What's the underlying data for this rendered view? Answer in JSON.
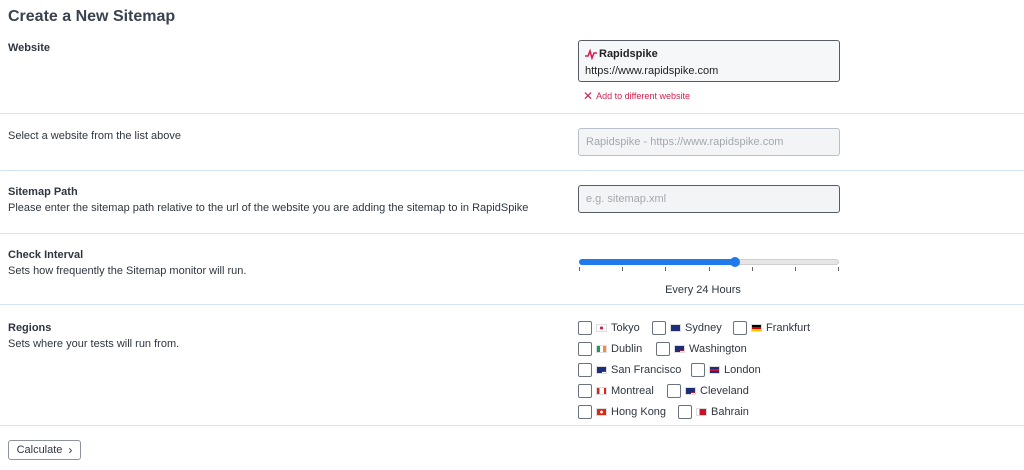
{
  "page": {
    "title": "Create a New Sitemap"
  },
  "website": {
    "label": "Website",
    "selected_name": "Rapidspike",
    "selected_url": "https://www.rapidspike.com",
    "add_link": "Add to different website",
    "brand_color": "#d5204f"
  },
  "select_site": {
    "help": "Select a website from the list above",
    "placeholder": "Rapidspike - https://www.rapidspike.com"
  },
  "sitemap_path": {
    "label": "Sitemap Path",
    "help": "Please enter the sitemap path relative to the url of the website you are adding the sitemap to in RapidSpike",
    "placeholder": "e.g. sitemap.xml"
  },
  "check_interval": {
    "label": "Check Interval",
    "help": "Sets how frequently the Sitemap monitor will run.",
    "value_label": "Every 24 Hours",
    "slider_fraction": 0.6,
    "tick_count": 7,
    "accent_color": "#1f7aec"
  },
  "regions": {
    "label": "Regions",
    "help": "Sets where your tests will run from.",
    "items": [
      {
        "name": "Tokyo",
        "flag": "japan-flag",
        "checked": false
      },
      {
        "name": "Sydney",
        "flag": "australia-flag",
        "checked": false
      },
      {
        "name": "Frankfurt",
        "flag": "germany-flag",
        "checked": false
      },
      {
        "name": "Dublin",
        "flag": "ireland-flag",
        "checked": false
      },
      {
        "name": "Washington",
        "flag": "usa-flag",
        "checked": false
      },
      {
        "name": "San Francisco",
        "flag": "usa-flag",
        "checked": false
      },
      {
        "name": "London",
        "flag": "uk-flag",
        "checked": false
      },
      {
        "name": "Montreal",
        "flag": "canada-flag",
        "checked": false
      },
      {
        "name": "Cleveland",
        "flag": "usa-flag",
        "checked": false
      },
      {
        "name": "Hong Kong",
        "flag": "hong-kong-flag",
        "checked": false
      },
      {
        "name": "Bahrain",
        "flag": "bahrain-flag",
        "checked": false
      }
    ]
  },
  "actions": {
    "calculate_label": "Calculate"
  }
}
